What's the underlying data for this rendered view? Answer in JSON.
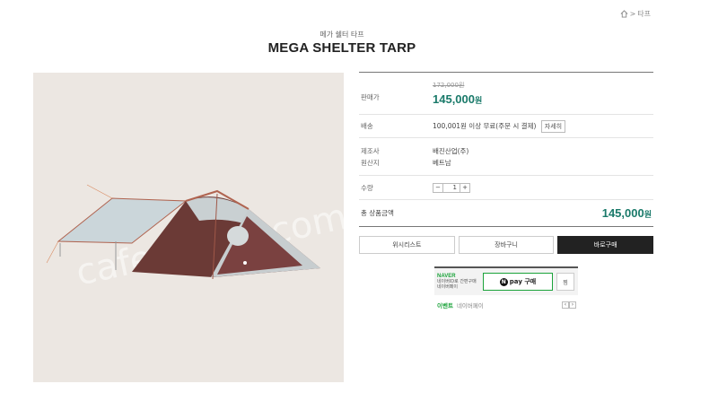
{
  "breadcrumb": {
    "separator": ">",
    "current": "타프"
  },
  "product": {
    "subtitle": "메가 쉘터 타프",
    "title": "MEGA SHELTER TARP",
    "watermark": "cafe.naver.com/joonggonara"
  },
  "price": {
    "label": "판매가",
    "original": "172,000원",
    "sale": "145,000",
    "sale_unit": "원"
  },
  "shipping": {
    "label": "배송",
    "text": "100,001원 이상 무료(주문 시 결제)",
    "detail_button": "자세히"
  },
  "maker": {
    "label": "제조사",
    "value": "배진산업(주)",
    "origin_label": "원산지",
    "origin_value": "베트남"
  },
  "quantity": {
    "label": "수량",
    "minus": "−",
    "value": "1",
    "plus": "+"
  },
  "total": {
    "label": "총 상품금액",
    "value": "145,000",
    "unit": "원"
  },
  "actions": {
    "wishlist": "위시리스트",
    "cart": "장바구니",
    "buy": "바로구매"
  },
  "npay": {
    "brand": "NAVER",
    "line1": "네이버ID로 간편구매",
    "line2": "네이버페이",
    "button_label": "pay 구매",
    "button_icon": "N",
    "wish_label": "찜"
  },
  "event": {
    "label": "이벤트",
    "text": "네이버페이",
    "prev": "‹",
    "next": "›"
  },
  "colors": {
    "accent_price": "#1a7a6a",
    "naver_green": "#1ba33a",
    "buy_button": "#222222"
  }
}
